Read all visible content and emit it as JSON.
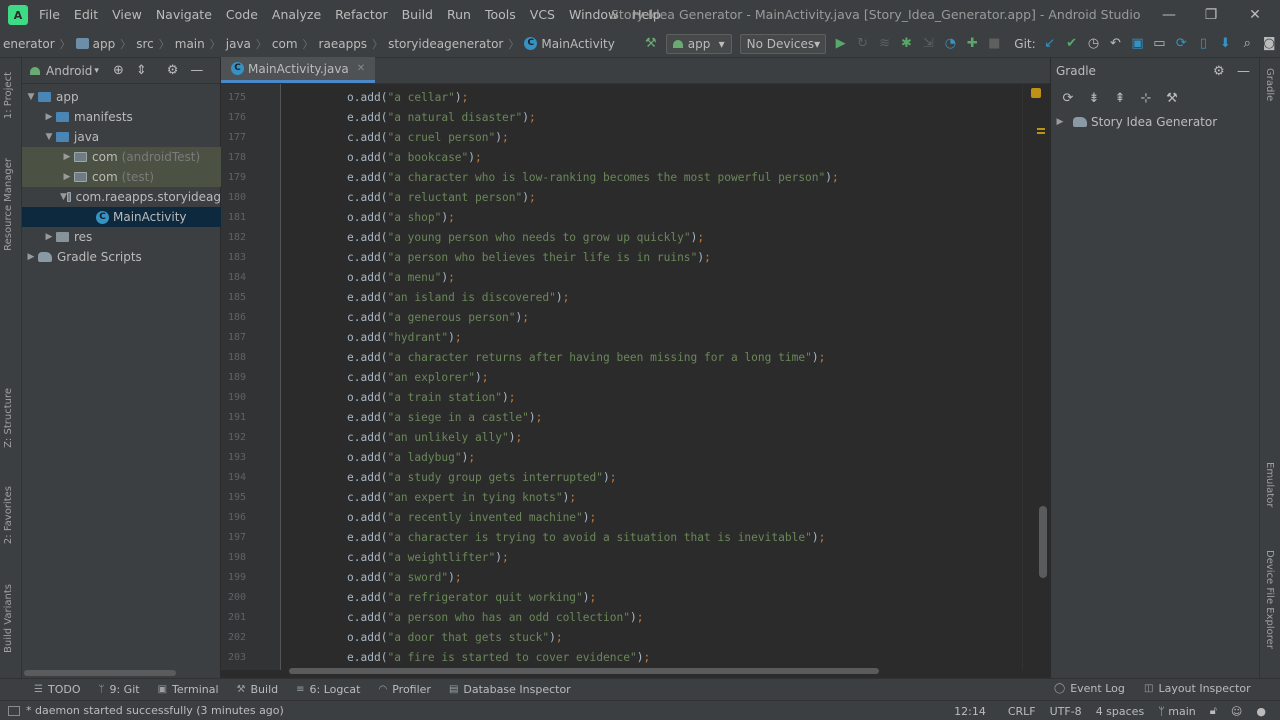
{
  "window": {
    "title": "Story Idea Generator - MainActivity.java [Story_Idea_Generator.app] - Android Studio",
    "logo_text": "A",
    "minimize": "—",
    "maximize": "❐",
    "close": "✕"
  },
  "menu": [
    "File",
    "Edit",
    "View",
    "Navigate",
    "Code",
    "Analyze",
    "Refactor",
    "Build",
    "Run",
    "Tools",
    "VCS",
    "Window",
    "Help"
  ],
  "breadcrumb": [
    "enerator",
    "app",
    "src",
    "main",
    "java",
    "com",
    "raeapps",
    "storyideagenerator",
    "MainActivity"
  ],
  "toolbar": {
    "run_config": "app",
    "device": "No Devices",
    "git_label": "Git:",
    "dropdown_arrow": "▾"
  },
  "project_panel": {
    "view_selector": "Android",
    "tree": [
      {
        "label": "app",
        "suffix": ""
      },
      {
        "label": "manifests",
        "suffix": ""
      },
      {
        "label": "java",
        "suffix": ""
      },
      {
        "label": "com",
        "suffix": "(androidTest)"
      },
      {
        "label": "com",
        "suffix": "(test)"
      },
      {
        "label": "com.raeapps.storyideag",
        "suffix": ""
      },
      {
        "label": "MainActivity",
        "suffix": ""
      },
      {
        "label": "res",
        "suffix": ""
      },
      {
        "label": "Gradle Scripts",
        "suffix": ""
      }
    ]
  },
  "left_stripe": [
    "1: Project",
    "Resource Manager",
    "Z: Structure",
    "2: Favorites",
    "Build Variants"
  ],
  "editor": {
    "tab": "MainActivity.java",
    "lines": [
      {
        "no": "175",
        "obj": "o",
        "text": "a cellar"
      },
      {
        "no": "176",
        "obj": "e",
        "text": "a natural disaster"
      },
      {
        "no": "177",
        "obj": "c",
        "text": "a cruel person"
      },
      {
        "no": "178",
        "obj": "o",
        "text": "a bookcase"
      },
      {
        "no": "179",
        "obj": "e",
        "text": "a character who is low-ranking becomes the most powerful person"
      },
      {
        "no": "180",
        "obj": "c",
        "text": "a reluctant person"
      },
      {
        "no": "181",
        "obj": "o",
        "text": "a shop"
      },
      {
        "no": "182",
        "obj": "e",
        "text": "a young person who needs to grow up quickly"
      },
      {
        "no": "183",
        "obj": "c",
        "text": "a person who believes their life is in ruins"
      },
      {
        "no": "184",
        "obj": "o",
        "text": "a menu"
      },
      {
        "no": "185",
        "obj": "e",
        "text": "an island is discovered"
      },
      {
        "no": "186",
        "obj": "c",
        "text": "a generous person"
      },
      {
        "no": "187",
        "obj": "o",
        "text": "hydrant"
      },
      {
        "no": "188",
        "obj": "e",
        "text": "a character returns after having been missing for a long time"
      },
      {
        "no": "189",
        "obj": "c",
        "text": "an explorer"
      },
      {
        "no": "190",
        "obj": "o",
        "text": "a train station"
      },
      {
        "no": "191",
        "obj": "e",
        "text": "a siege in a castle"
      },
      {
        "no": "192",
        "obj": "c",
        "text": "an unlikely ally"
      },
      {
        "no": "193",
        "obj": "o",
        "text": "a ladybug"
      },
      {
        "no": "194",
        "obj": "e",
        "text": "a study group gets interrupted"
      },
      {
        "no": "195",
        "obj": "c",
        "text": "an expert in tying knots"
      },
      {
        "no": "196",
        "obj": "o",
        "text": "a recently invented machine"
      },
      {
        "no": "197",
        "obj": "e",
        "text": "a character is trying to avoid a situation that is inevitable"
      },
      {
        "no": "198",
        "obj": "c",
        "text": "a weightlifter"
      },
      {
        "no": "199",
        "obj": "o",
        "text": "a sword"
      },
      {
        "no": "200",
        "obj": "e",
        "text": "a refrigerator quit working"
      },
      {
        "no": "201",
        "obj": "c",
        "text": "a person who has an odd collection"
      },
      {
        "no": "202",
        "obj": "o",
        "text": "a door that gets stuck"
      },
      {
        "no": "203",
        "obj": "e",
        "text": "a fire is started to cover evidence"
      }
    ]
  },
  "gradle_panel": {
    "title": "Gradle",
    "tree_item": "Story Idea Generator"
  },
  "right_stripe": [
    "Gradle",
    "Emulator",
    "Device File Explorer"
  ],
  "bottom_tools": [
    "TODO",
    "9: Git",
    "Terminal",
    "Build",
    "6: Logcat",
    "Profiler",
    "Database Inspector"
  ],
  "bottom_tools_right": [
    "Event Log",
    "Layout Inspector"
  ],
  "status": {
    "message": "* daemon started successfully (3 minutes ago)",
    "position": "12:14",
    "line_sep": "CRLF",
    "encoding": "UTF-8",
    "indent": "4 spaces",
    "branch": "main"
  },
  "colors": {
    "string": "#6a8759",
    "code": "#a9b7c6",
    "keyword": "#cc7832",
    "selection": "#0d293e"
  }
}
